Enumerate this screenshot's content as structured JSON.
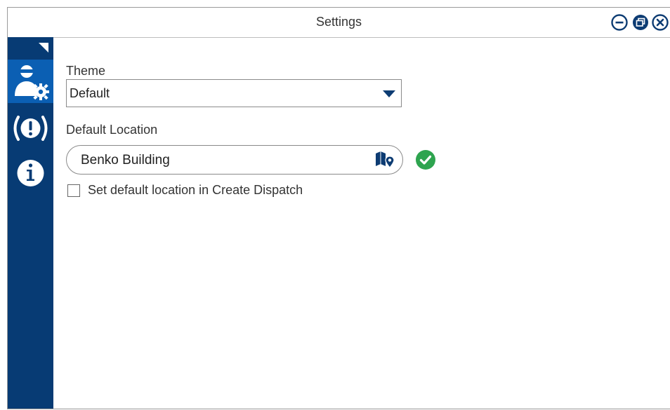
{
  "window": {
    "title": "Settings",
    "controls": {
      "minimize_icon": "circle-minus-icon",
      "restore_icon": "circle-restore-icon",
      "close_icon": "circle-close-icon"
    }
  },
  "sidebar": {
    "collapse_icon": "collapse-triangle-icon",
    "items": [
      {
        "name": "user-settings",
        "icon": "user-gear-icon",
        "active": true
      },
      {
        "name": "alerts",
        "icon": "alert-broadcast-icon",
        "active": false
      },
      {
        "name": "about",
        "icon": "info-icon",
        "active": false
      }
    ]
  },
  "settings": {
    "theme_label": "Theme",
    "theme_value": "Default",
    "default_location_label": "Default Location",
    "location_value": "Benko Building",
    "location_valid_icon": "check-circle-icon",
    "map_icon": "map-pin-icon",
    "checkbox_label": "Set default location in Create Dispatch",
    "checkbox_checked": false
  },
  "colors": {
    "sidebar": "#073b74",
    "sidebar_active": "#0b5fb3",
    "accent_icon": "#0d3c73",
    "success": "#2ea44f"
  }
}
